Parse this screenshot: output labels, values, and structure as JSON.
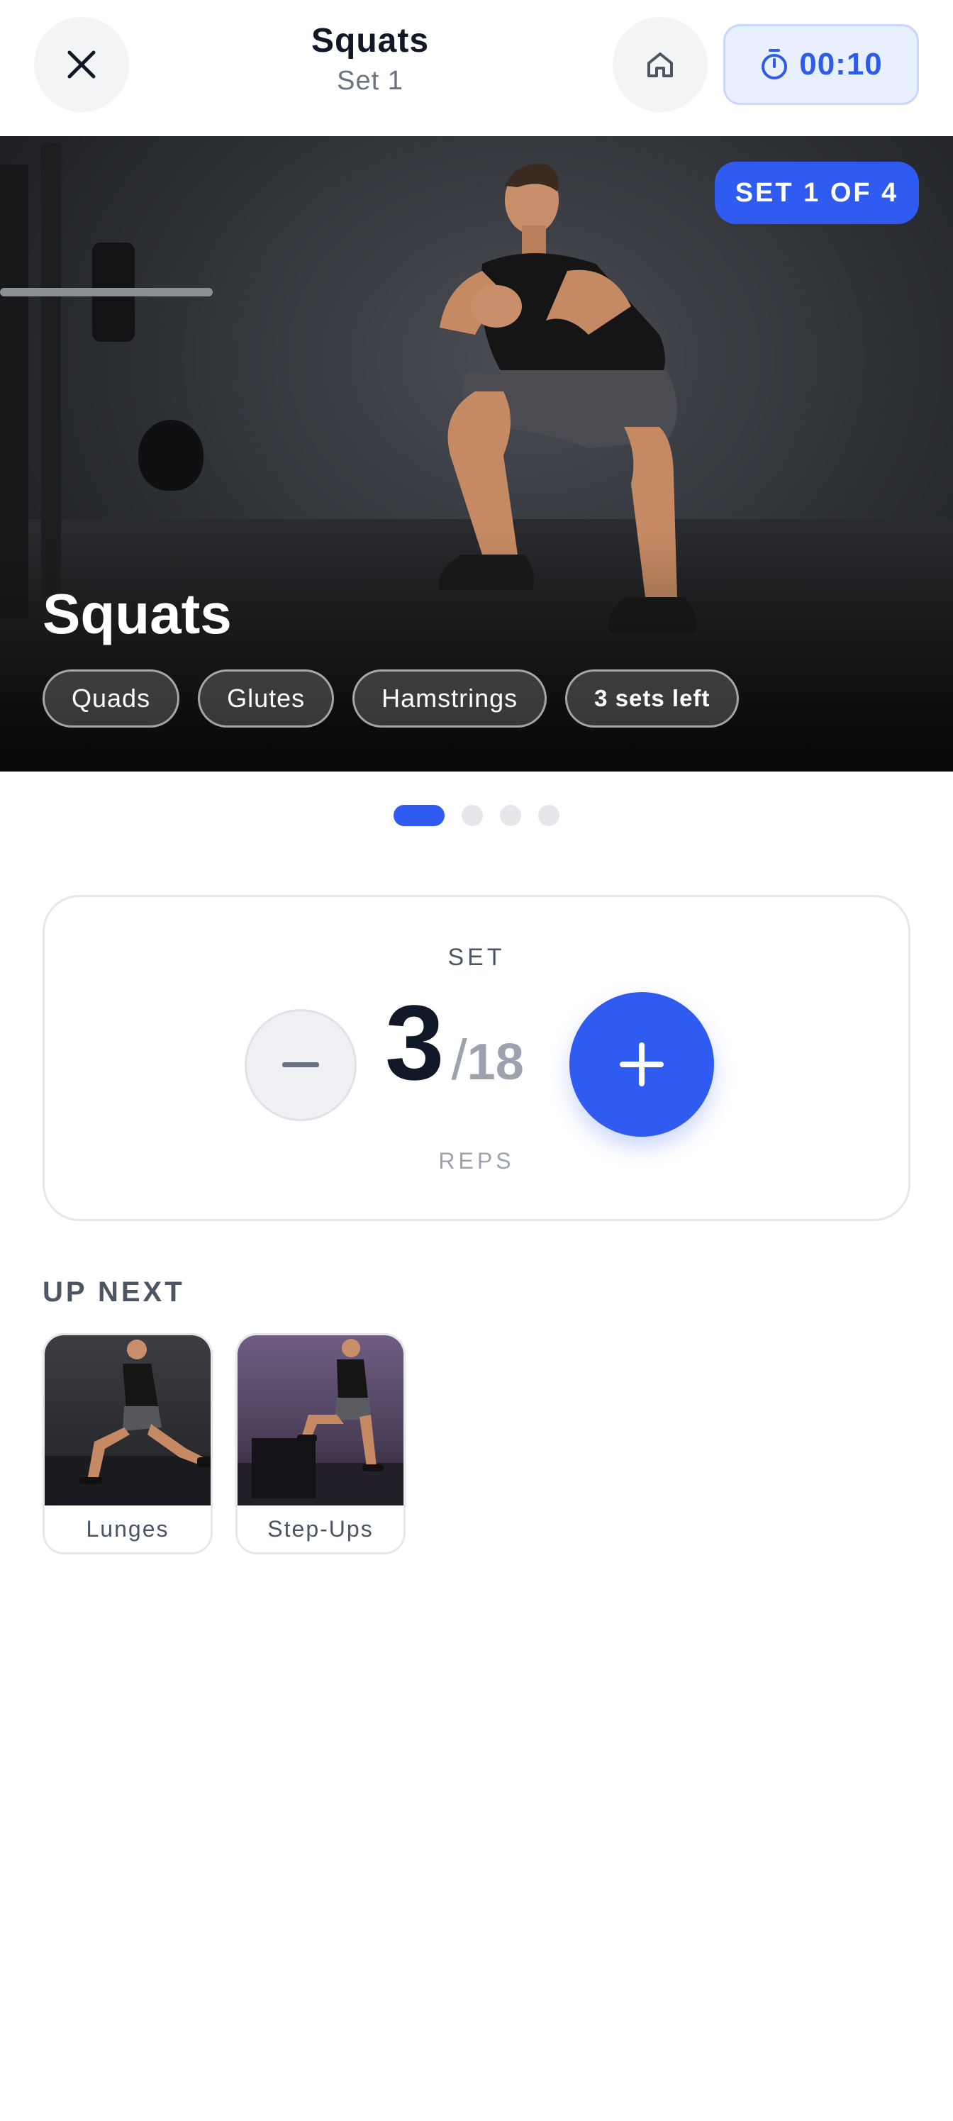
{
  "header": {
    "title": "Squats",
    "subtitle": "Set 1",
    "timer": "00:10"
  },
  "hero": {
    "set_badge": "SET 1 OF 4",
    "title": "Squats",
    "tags": [
      "Quads",
      "Glutes",
      "Hamstrings"
    ],
    "sets_left": "3 sets left"
  },
  "pager": {
    "total": 4,
    "active_index": 0
  },
  "reps": {
    "label": "SET",
    "current": "3",
    "separator": "/",
    "total": "18",
    "unit_label": "REPS"
  },
  "up_next": {
    "title": "UP NEXT",
    "items": [
      {
        "label": "Lunges"
      },
      {
        "label": "Step-Ups"
      }
    ]
  },
  "colors": {
    "accent": "#2f5bf0",
    "timer_bg": "#e8efff",
    "text_primary": "#111827",
    "text_muted": "#9ca3af"
  },
  "icons": {
    "close": "close-icon",
    "home": "home-icon",
    "timer": "stopwatch-icon",
    "minus": "minus-icon",
    "plus": "plus-icon"
  }
}
